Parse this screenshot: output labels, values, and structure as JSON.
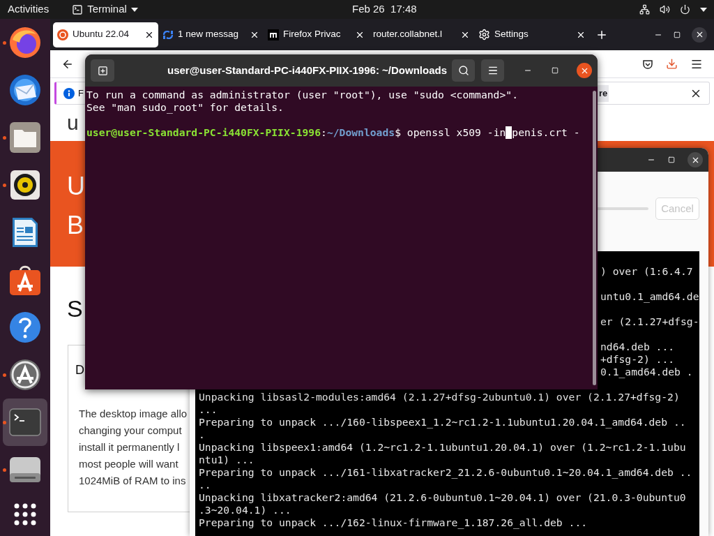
{
  "top_bar": {
    "activities": "Activities",
    "app_menu": "Terminal",
    "clock": "Feb 26  17:48"
  },
  "dock": {
    "items": [
      {
        "kind": "firefox",
        "running": true,
        "selected": false
      },
      {
        "kind": "mail",
        "running": false,
        "selected": false
      },
      {
        "kind": "files",
        "running": true,
        "selected": false
      },
      {
        "kind": "music",
        "running": true,
        "selected": false
      },
      {
        "kind": "writer",
        "running": false,
        "selected": false
      },
      {
        "kind": "software",
        "running": false,
        "selected": false
      },
      {
        "kind": "help",
        "running": false,
        "selected": false
      },
      {
        "kind": "updater",
        "running": true,
        "selected": false
      },
      {
        "kind": "terminal",
        "running": true,
        "selected": true
      },
      {
        "kind": "disk",
        "running": true,
        "selected": false
      },
      {
        "kind": "apps",
        "running": false,
        "selected": false
      }
    ]
  },
  "browser": {
    "tabs": [
      {
        "title": "Ubuntu 22.04",
        "selected": true
      },
      {
        "title": "1 new messag",
        "selected": false
      },
      {
        "title": "Firefox Privac",
        "selected": false
      },
      {
        "title": "router.collabnet.l",
        "selected": false
      },
      {
        "title": "Settings",
        "selected": false
      }
    ],
    "notification": {
      "text": "F",
      "button": "re"
    },
    "page": {
      "logo": "u",
      "banner_lines": [
        "U",
        "B"
      ],
      "heading": "S",
      "card": {
        "title": "D",
        "lines": [
          "The desktop image allo",
          "changing your comput",
          "install it permanently l",
          "most people will want",
          "1024MiB of RAM to ins"
        ]
      }
    }
  },
  "installer": {
    "cancel": {
      "label": "Cancel",
      "disabled": true
    },
    "partial_lines": [
      ") over (1:6.4.7",
      "untu0.1_amd64.de",
      "er (2.1.27+dfsg-",
      "nd64.deb ...",
      "+dfsg-2) ...",
      "0.1_amd64.deb ."
    ],
    "lines": [
      "Unpacking libsasl2-modules:amd64 (2.1.27+dfsg-2ubuntu0.1) over (2.1.27+dfsg-2)",
      "...",
      "Preparing to unpack .../160-libspeex1_1.2~rc1.2-1.1ubuntu1.20.04.1_amd64.deb ..",
      ".",
      "Unpacking libspeex1:amd64 (1.2~rc1.2-1.1ubuntu1.20.04.1) over (1.2~rc1.2-1.1ubu",
      "ntu1) ...",
      "Preparing to unpack .../161-libxatracker2_21.2.6-0ubuntu0.1~20.04.1_amd64.deb ..",
      "..",
      "Unpacking libxatracker2:amd64 (21.2.6-0ubuntu0.1~20.04.1) over (21.0.3-0ubuntu0",
      ".3~20.04.1) ...",
      "Preparing to unpack .../162-linux-firmware_1.187.26_all.deb ..."
    ]
  },
  "terminal": {
    "title": "user@user-Standard-PC-i440FX-PIIX-1996: ~/Downloads",
    "lines": [
      "To run a command as administrator (user \"root\"), use \"sudo <command>\".",
      "See \"man sudo_root\" for details."
    ],
    "prompt": {
      "user_host": "user@user-Standard-PC-i440FX-PIIX-1996",
      "separator": ":",
      "path": "~/Downloads",
      "before_cursor": "$ openssl x509 -in",
      "after_cursor": "penis.crt -"
    }
  }
}
